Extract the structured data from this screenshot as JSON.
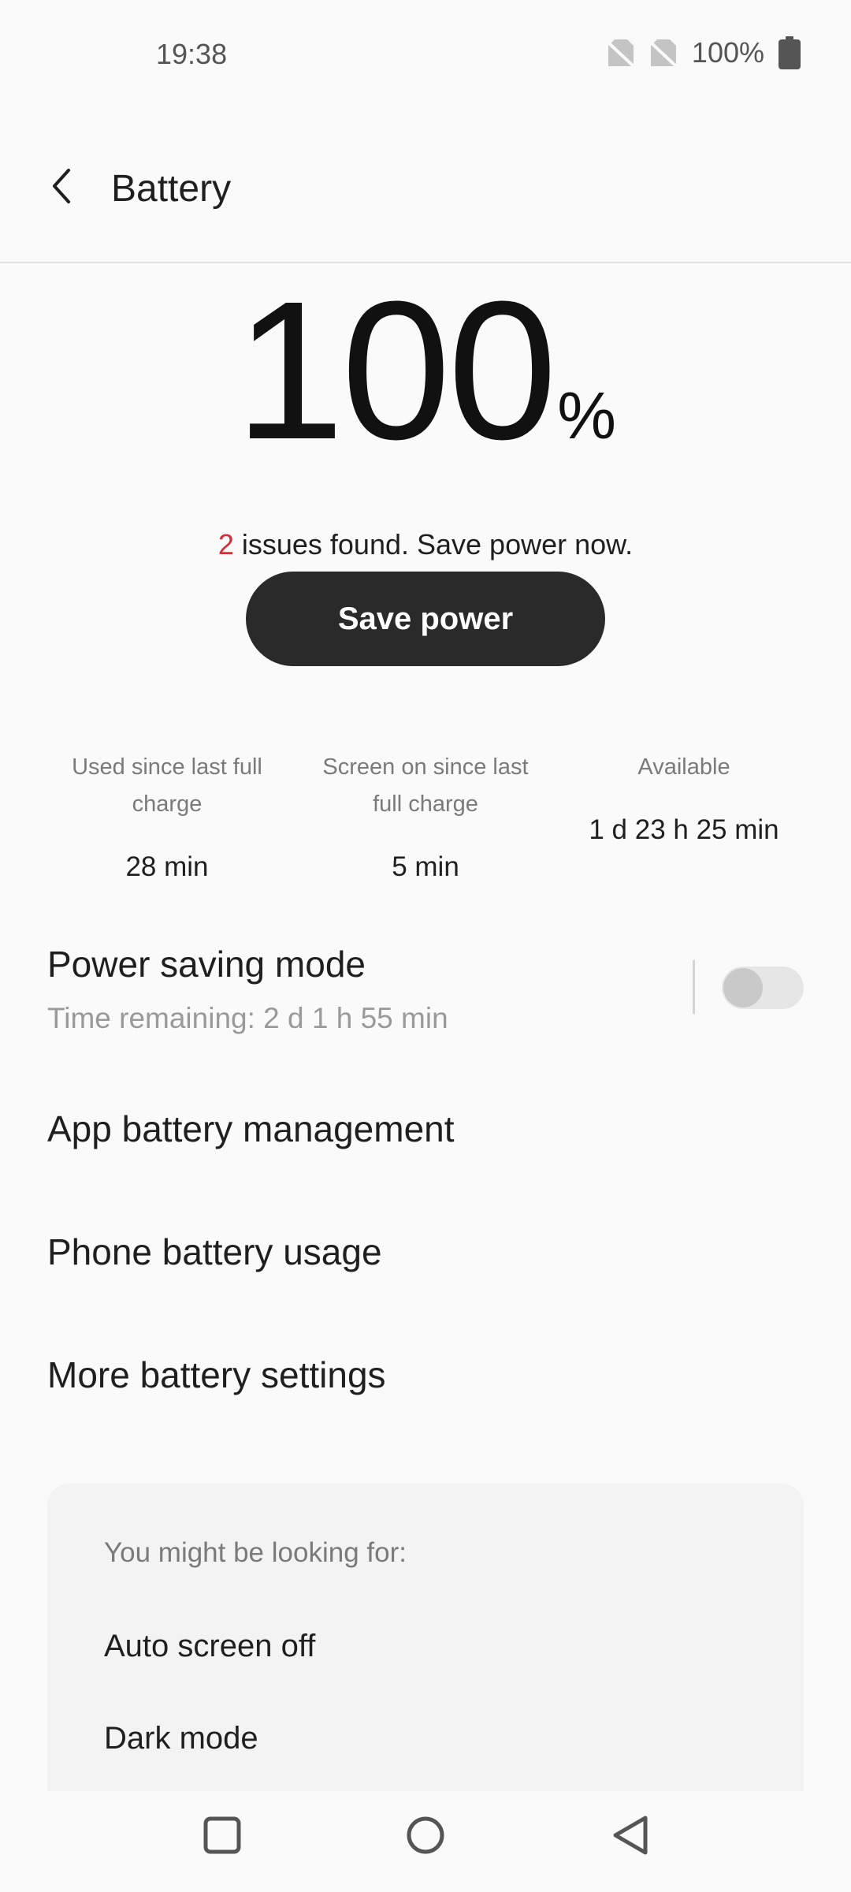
{
  "status_bar": {
    "time": "19:38",
    "battery_text": "100%",
    "icons": [
      "no-sim-icon",
      "no-sim-icon",
      "battery-full-icon"
    ]
  },
  "header": {
    "back_icon": "chevron-left-icon",
    "title": "Battery"
  },
  "battery": {
    "level": 100,
    "level_text": "100",
    "percent_sign": "%",
    "issues_count": "2",
    "issues_text": " issues found. Save power now.",
    "save_button_label": "Save power"
  },
  "stats": [
    {
      "label": "Used since last full charge",
      "value": "28 min"
    },
    {
      "label": "Screen on since last full charge",
      "value": "5 min"
    },
    {
      "label": "Available",
      "value": "1 d 23 h 25 min"
    }
  ],
  "settings": {
    "power_saving": {
      "title": "Power saving mode",
      "subtitle": "Time remaining:  2 d 1 h 55 min",
      "enabled": false
    },
    "items": [
      {
        "label": "App battery management"
      },
      {
        "label": "Phone battery usage"
      },
      {
        "label": "More battery settings"
      }
    ]
  },
  "suggestions": {
    "heading": "You might be looking for:",
    "items": [
      {
        "label": "Auto screen off"
      },
      {
        "label": "Dark mode"
      }
    ]
  },
  "nav_bar": {
    "icons": [
      "recents-square-icon",
      "home-circle-icon",
      "back-triangle-icon"
    ]
  },
  "colors": {
    "background": "#FAFAFA",
    "accent_red": "#D0303C",
    "button_dark": "#2A2A2A",
    "card_bg": "#F3F3F3"
  }
}
